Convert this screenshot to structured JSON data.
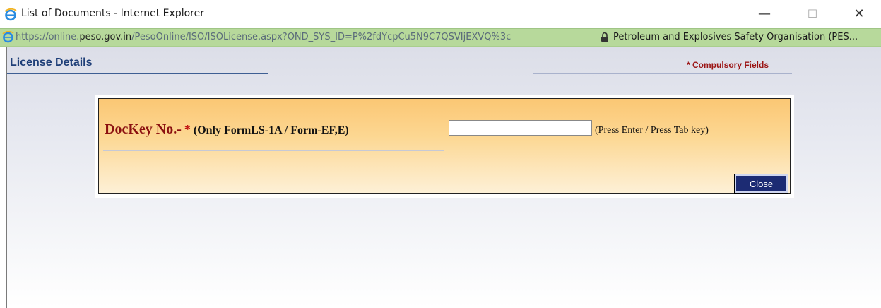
{
  "window": {
    "title": "List of Documents - Internet Explorer",
    "minimize_glyph": "—",
    "maximize_glyph": "☐",
    "close_glyph": "✕"
  },
  "address_bar": {
    "url_prefix": "https://online.",
    "url_domain": "peso.gov.in",
    "url_path": "/PesoOnline/ISO/ISOLicense.aspx?OND_SYS_ID=P%2fdYcpCu5N9C7QSVIjEXVQ%3c",
    "site_identity": "Petroleum and Explosives Safety Organisation (PES..."
  },
  "page": {
    "section_title": "License Details",
    "compulsory_note": "* Compulsory Fields"
  },
  "form": {
    "dockey_label": "DocKey No.-",
    "required_marker": "*",
    "dockey_sublabel": "(Only FormLS-1A / Form-EF,E)",
    "dockey_value": "",
    "hint": "(Press Enter / Press Tab key)",
    "close_label": "Close"
  },
  "colors": {
    "address_bar_bg": "#b7d99b",
    "title_blue": "#1f3f78",
    "compulsory_red": "#9b1414",
    "label_red": "#8b1010",
    "panel_orange": "#fbc774",
    "button_navy": "#1c2b73"
  },
  "icons": [
    "internet-explorer-icon",
    "lock-icon"
  ]
}
